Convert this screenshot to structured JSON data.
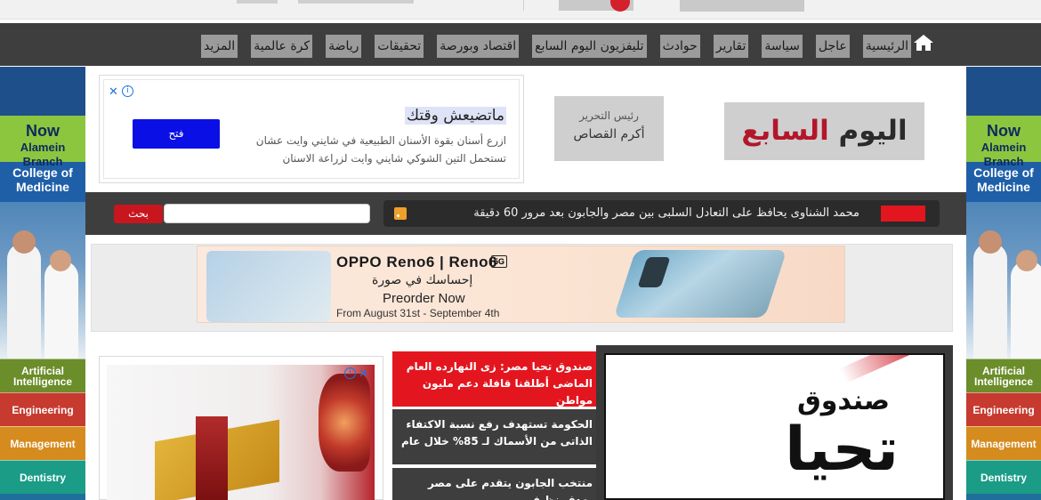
{
  "nav": {
    "items": [
      "الرئيسية",
      "عاجل",
      "سياسة",
      "تقارير",
      "حوادث",
      "تليفزيون اليوم السابع",
      "اقتصاد وبورصة",
      "تحقيقات",
      "رياضة",
      "كرة عالمية",
      "المزيد"
    ]
  },
  "side_banner": {
    "now": "Now",
    "branch": "Alamein Branch",
    "college": "College of Medicine",
    "tabs": [
      "Artificial Intelligence",
      "Engineering",
      "Management",
      "Dentistry"
    ]
  },
  "header": {
    "logo_part1": "اليوم",
    "logo_part2": "السابع",
    "editor_title": "رئيس التحرير",
    "editor_name": "أكرم القصاص"
  },
  "ad_top": {
    "title": "ماتضيعش وقتك",
    "line1": "ازرع أسنان بقوة الأسنان الطبيعية في شايني وايت عشان",
    "line2": "تستحمل التين الشوكي شايني وايت لزراعة الاسنان",
    "button": "فتح"
  },
  "ticker": {
    "text": "محمد الشناوى يحافظ على التعادل السلبى بين مصر والجابون بعد مرور 60 دقيقة"
  },
  "search": {
    "placeholder": "",
    "button": "بحث"
  },
  "oppo_ad": {
    "brand": "OPPO Reno6 | Reno6",
    "badge": "5G",
    "tagline": "إحساسك في صورة",
    "cta": "Preorder Now",
    "dates": "From August 31st - September 4th"
  },
  "news": [
    "صندوق تحيا مصر: زى النهارده العام الماضى أطلقنا قافلة دعم مليون مواطن",
    "الحكومة تستهدف رفع نسبة الاكتفاء الذاتى من الأسماك لـ 85% خلال عام",
    "منتخب الجابون يتقدم على مصر بهدف نظيف"
  ],
  "featured": {
    "line1": "صندوق",
    "line2": "تحيا"
  }
}
